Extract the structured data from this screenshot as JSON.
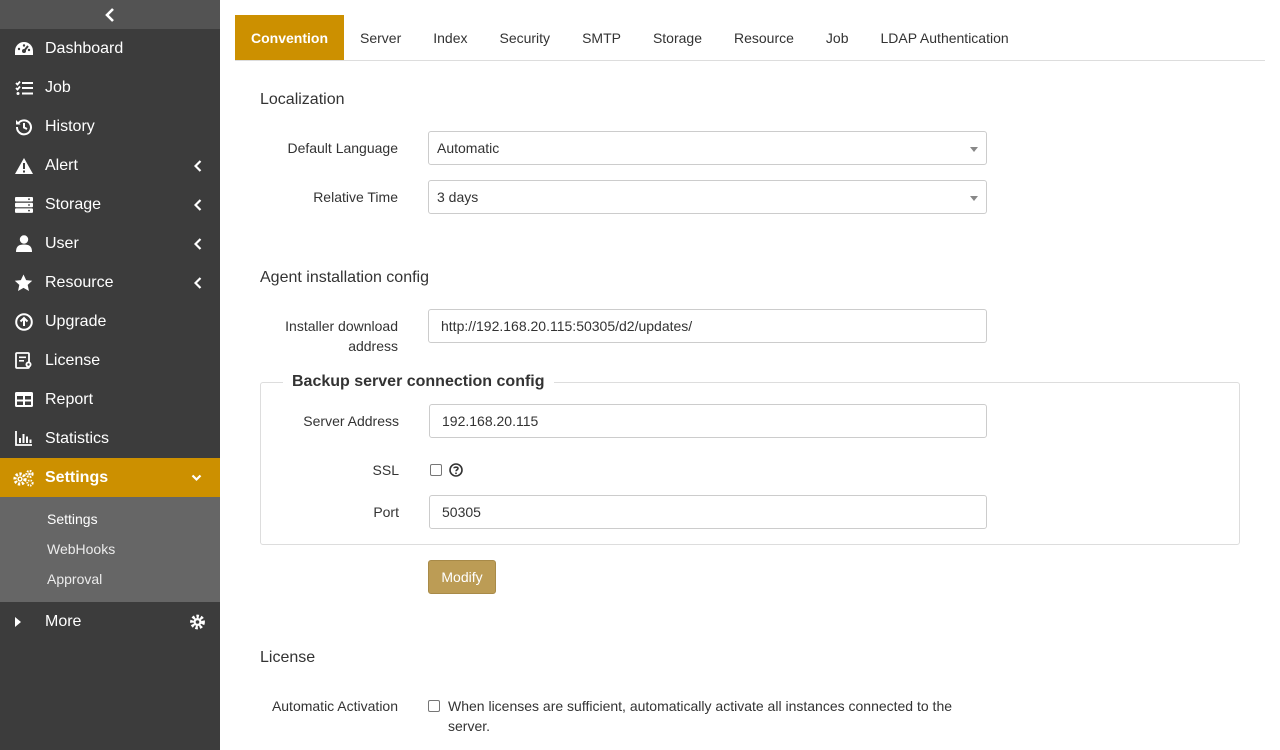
{
  "sidebar": {
    "items": [
      {
        "label": "Dashboard",
        "icon": "dashboard-icon"
      },
      {
        "label": "Job",
        "icon": "tasks-icon"
      },
      {
        "label": "History",
        "icon": "history-icon"
      },
      {
        "label": "Alert",
        "icon": "warning-icon"
      },
      {
        "label": "Storage",
        "icon": "storage-icon"
      },
      {
        "label": "User",
        "icon": "user-icon"
      },
      {
        "label": "Resource",
        "icon": "star-icon"
      },
      {
        "label": "Upgrade",
        "icon": "upgrade-icon"
      },
      {
        "label": "License",
        "icon": "license-icon"
      },
      {
        "label": "Report",
        "icon": "table-icon"
      },
      {
        "label": "Statistics",
        "icon": "bar-chart-icon"
      },
      {
        "label": "Settings",
        "icon": "cogs-icon"
      }
    ],
    "submenu": [
      "Settings",
      "WebHooks",
      "Approval"
    ],
    "more_label": "More",
    "accent_color": "#cc9000"
  },
  "tabs": [
    "Convention",
    "Server",
    "Index",
    "Security",
    "SMTP",
    "Storage",
    "Resource",
    "Job",
    "LDAP Authentication"
  ],
  "localization": {
    "title": "Localization",
    "default_language_label": "Default Language",
    "default_language_value": "Automatic",
    "relative_time_label": "Relative Time",
    "relative_time_value": "3 days"
  },
  "agent": {
    "title": "Agent installation config",
    "installer_label_1": "Installer download",
    "installer_label_2": "address",
    "installer_value": "http://192.168.20.115:50305/d2/updates/"
  },
  "backup": {
    "legend": "Backup server connection config",
    "server_address_label": "Server Address",
    "server_address_value": "192.168.20.115",
    "ssl_label": "SSL",
    "ssl_checked": false,
    "port_label": "Port",
    "port_value": "50305",
    "modify_label": "Modify"
  },
  "license": {
    "title": "License",
    "auto_activation_label": "Automatic Activation",
    "auto_activation_text": "When licenses are sufficient, automatically activate all instances connected to the server.",
    "auto_activation_checked": false
  }
}
